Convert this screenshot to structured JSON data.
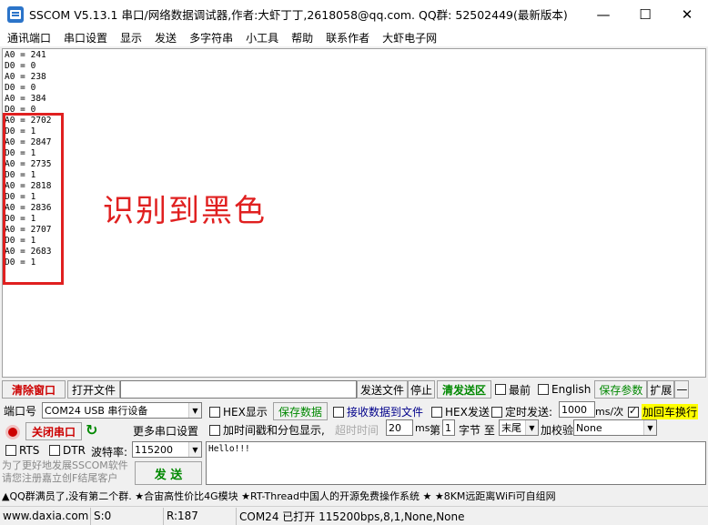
{
  "titlebar": {
    "title": "SSCOM V5.13.1 串口/网络数据调试器,作者:大虾丁丁,2618058@qq.com. QQ群: 52502449(最新版本)",
    "minimize": "—",
    "maximize": "☐",
    "close": "✕"
  },
  "menu": [
    "通讯端口",
    "串口设置",
    "显示",
    "发送",
    "多字符串",
    "小工具",
    "帮助",
    "联系作者",
    "大虾电子网"
  ],
  "terminal": {
    "lines": "A0 = 241\nD0 = 0\nA0 = 238\nD0 = 0\nA0 = 384\nD0 = 0\nA0 = 2702\nD0 = 1\nA0 = 2847\nD0 = 1\nA0 = 2735\nD0 = 1\nA0 = 2818\nD0 = 1\nA0 = 2836\nD0 = 1\nA0 = 2707\nD0 = 1\nA0 = 2683\nD0 = 1",
    "annotation": "识别到黑色"
  },
  "toolbar": {
    "clear_window": "清除窗口",
    "open_file": "打开文件",
    "file_path": "",
    "send_file": "发送文件",
    "stop": "停止",
    "clear_send": "清发送区",
    "topmost": "最前",
    "english": "English",
    "save_params": "保存参数",
    "expand": "扩展",
    "more": "—"
  },
  "port": {
    "label": "端口号",
    "value": "COM24 USB 串行设备",
    "close_button": "关闭串口",
    "more_settings": "更多串口设置",
    "rts": "RTS",
    "dtr": "DTR",
    "baud_label": "波特率:",
    "baud_value": "115200"
  },
  "options": {
    "hex_display": "HEX显示",
    "save_data": "保存数据",
    "receive_to_file": "接收数据到文件",
    "hex_send": "HEX发送",
    "timed_send": "定时发送:",
    "interval": "1000",
    "interval_unit": "ms/次",
    "add_crlf": "加回车换行",
    "timestamp": "加时间戳和分包显示,",
    "timeout_label": "超时时间",
    "timeout_value": "20",
    "timeout_unit": "ms",
    "frame_prefix": "第",
    "frame_value": "1",
    "byte_label": "字节 至",
    "end_value": "末尾",
    "checksum_label": "加校验",
    "checksum_value": "None"
  },
  "send": {
    "text": "Hello!!!",
    "button": "发 送",
    "promo": "为了更好地发展SSCOM软件\n请您注册嘉立创F结尾客户"
  },
  "adbar": "▲QQ群满员了,没有第二个群. ★合宙高性价比4G模块 ★RT-Thread中国人的开源免费操作系统 ★ ★8KM远距离WiFi可自组网",
  "status": {
    "site": "www.daxia.com",
    "sent": "S:0",
    "received": "R:187",
    "port_state": "COM24 已打开  115200bps,8,1,None,None"
  },
  "colors": {
    "annotation_red": "#e02020",
    "clear_red": "#cc0000",
    "green": "#008800"
  }
}
